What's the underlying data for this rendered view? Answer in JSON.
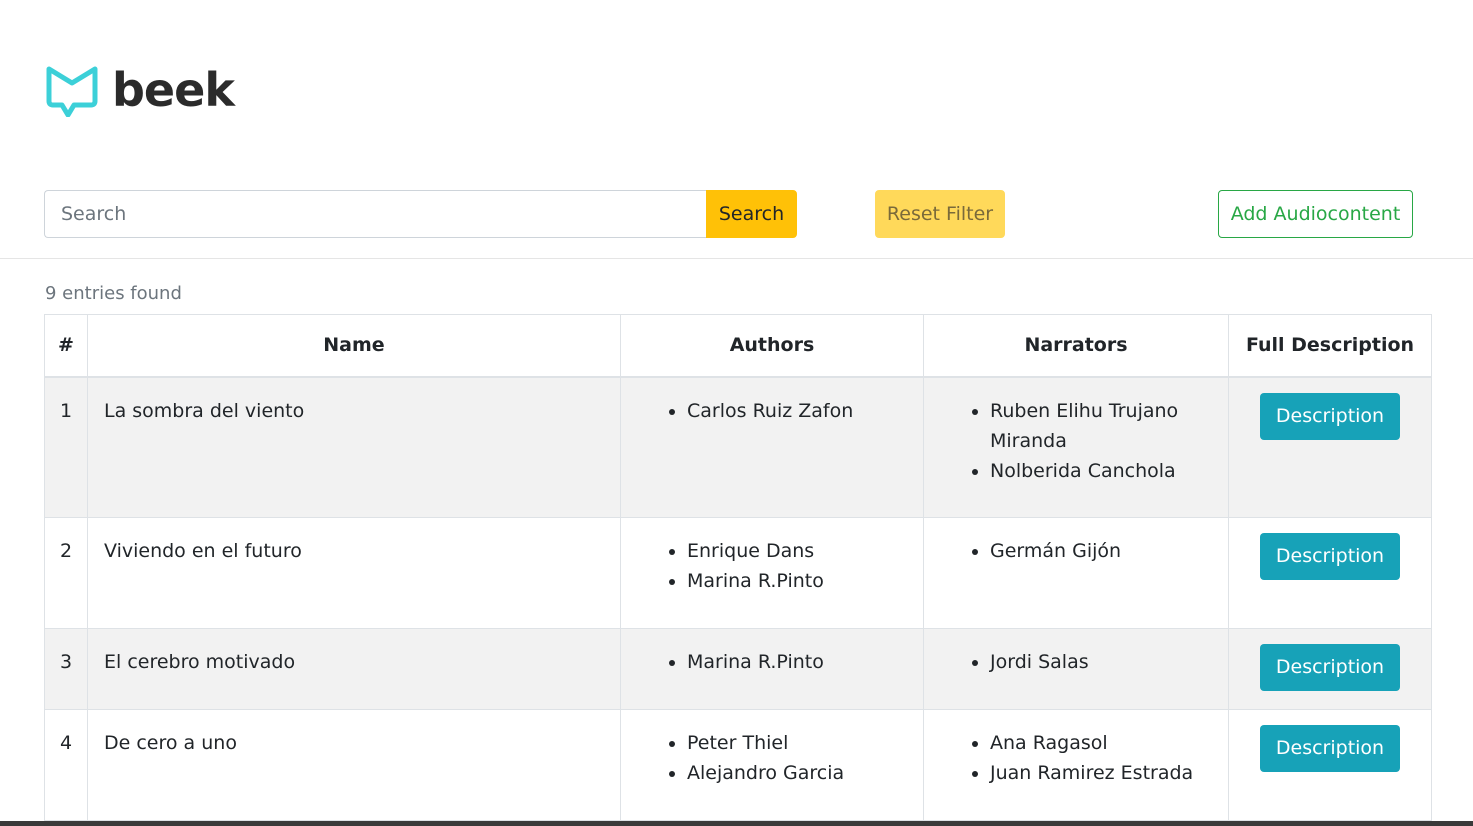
{
  "brand": {
    "name": "beek",
    "accent": "#3cd0d8"
  },
  "toolbar": {
    "search_placeholder": "Search",
    "search_label": "Search",
    "reset_label": "Reset Filter",
    "add_label": "Add Audiocontent"
  },
  "results": {
    "count_text": "9 entries found"
  },
  "table": {
    "headers": {
      "num": "#",
      "name": "Name",
      "authors": "Authors",
      "narrators": "Narrators",
      "description": "Full Description"
    },
    "rows": [
      {
        "num": "1",
        "name": "La sombra del viento",
        "authors": [
          "Carlos Ruiz Zafon"
        ],
        "narrators": [
          "Ruben Elihu Trujano Miranda",
          "Nolberida Canchola"
        ],
        "description_label": "Description"
      },
      {
        "num": "2",
        "name": "Viviendo en el futuro",
        "authors": [
          "Enrique Dans",
          "Marina R.Pinto"
        ],
        "narrators": [
          "Germán Gijón"
        ],
        "description_label": "Description"
      },
      {
        "num": "3",
        "name": "El cerebro motivado",
        "authors": [
          "Marina R.Pinto"
        ],
        "narrators": [
          "Jordi Salas"
        ],
        "description_label": "Description"
      },
      {
        "num": "4",
        "name": "De cero a uno",
        "authors": [
          "Peter Thiel",
          "Alejandro Garcia"
        ],
        "narrators": [
          "Ana Ragasol",
          "Juan Ramirez Estrada"
        ],
        "description_label": "Description"
      }
    ]
  }
}
